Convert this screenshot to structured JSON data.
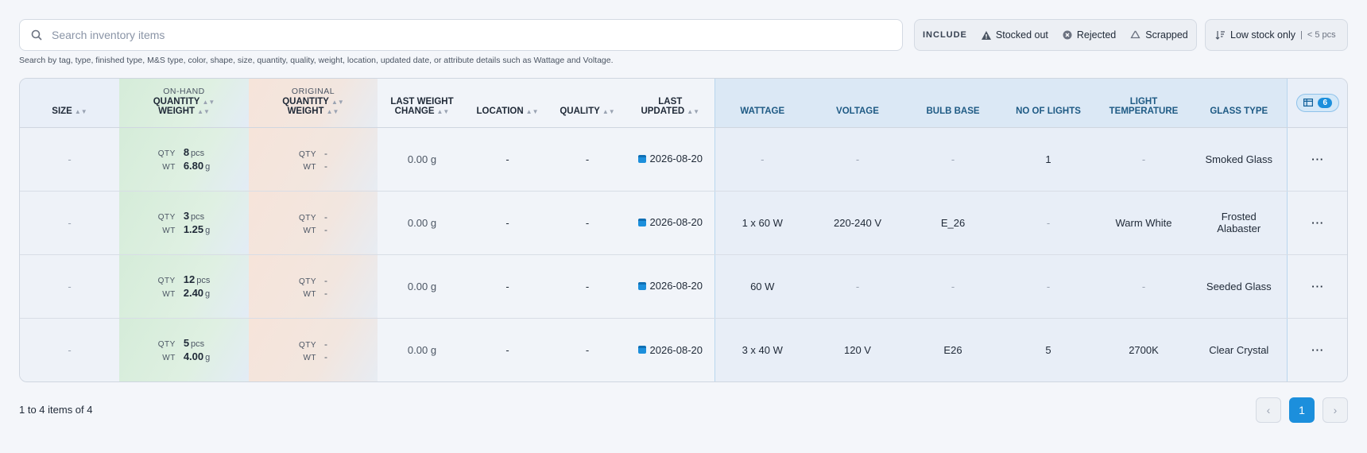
{
  "search": {
    "placeholder": "Search inventory items",
    "hint": "Search by tag, type, finished type, M&S type, color, shape, size, quantity, quality, weight, location, updated date, or attribute details such as Wattage and Voltage."
  },
  "filters": {
    "include_label": "INCLUDE",
    "stocked_out": "Stocked out",
    "rejected": "Rejected",
    "scrapped": "Scrapped",
    "low_stock_label": "Low stock only",
    "low_stock_sep": "|",
    "low_stock_threshold": "< 5 pcs"
  },
  "columns": {
    "size": "SIZE",
    "onhand_group": "ON-HAND",
    "original_group": "ORIGINAL",
    "quantity": "QUANTITY",
    "weight": "WEIGHT",
    "last_weight_change_1": "LAST WEIGHT",
    "last_weight_change_2": "CHANGE",
    "location": "LOCATION",
    "quality": "QUALITY",
    "last_updated_1": "LAST",
    "last_updated_2": "UPDATED",
    "wattage": "WATTAGE",
    "voltage": "VOLTAGE",
    "bulb_base": "BULB BASE",
    "no_of_lights": "NO OF LIGHTS",
    "light_temperature_1": "LIGHT",
    "light_temperature_2": "TEMPERATURE",
    "glass_type": "GLASS TYPE",
    "column_count": "6"
  },
  "labels": {
    "qty": "QTY",
    "wt": "WT",
    "pcs": "pcs",
    "g": "g"
  },
  "rows": [
    {
      "size": "-",
      "qty": "8",
      "wt": "6.80",
      "orig_qty": "-",
      "orig_wt": "-",
      "last_weight_change": "0.00 g",
      "location": "-",
      "quality": "-",
      "updated": "2026-08-20",
      "wattage": "-",
      "voltage": "-",
      "bulb_base": "-",
      "no_of_lights": "1",
      "light_temperature": "-",
      "glass_type": "Smoked Glass",
      "actions": "···"
    },
    {
      "size": "-",
      "qty": "3",
      "wt": "1.25",
      "orig_qty": "-",
      "orig_wt": "-",
      "last_weight_change": "0.00 g",
      "location": "-",
      "quality": "-",
      "updated": "2026-08-20",
      "wattage": "1 x 60 W",
      "voltage": "220-240 V",
      "bulb_base": "E_26",
      "no_of_lights": "-",
      "light_temperature": "Warm White",
      "glass_type": "Frosted Alabaster",
      "actions": "···"
    },
    {
      "size": "-",
      "qty": "12",
      "wt": "2.40",
      "orig_qty": "-",
      "orig_wt": "-",
      "last_weight_change": "0.00 g",
      "location": "-",
      "quality": "-",
      "updated": "2026-08-20",
      "wattage": "60 W",
      "voltage": "-",
      "bulb_base": "-",
      "no_of_lights": "-",
      "light_temperature": "-",
      "glass_type": "Seeded Glass",
      "actions": "···"
    },
    {
      "size": "-",
      "qty": "5",
      "wt": "4.00",
      "orig_qty": "-",
      "orig_wt": "-",
      "last_weight_change": "0.00 g",
      "location": "-",
      "quality": "-",
      "updated": "2026-08-20",
      "wattage": "3 x 40 W",
      "voltage": "120 V",
      "bulb_base": "E26",
      "no_of_lights": "5",
      "light_temperature": "2700K",
      "glass_type": "Clear Crystal",
      "actions": "···"
    }
  ],
  "pagination": {
    "summary": "1 to 4 items of 4",
    "current_page": "1",
    "prev": "‹",
    "next": "›"
  }
}
